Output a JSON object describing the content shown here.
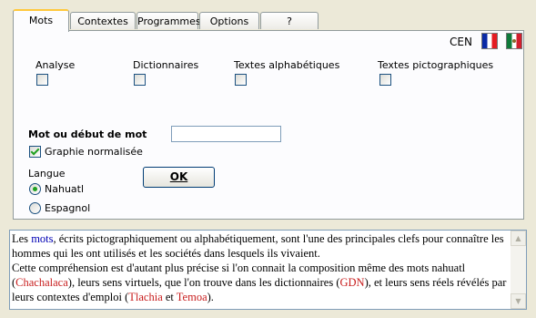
{
  "tabs": [
    {
      "label": "Mots",
      "active": true
    },
    {
      "label": "Contextes",
      "active": false
    },
    {
      "label": "Programmes",
      "active": false
    },
    {
      "label": "Options",
      "active": false
    },
    {
      "label": "?",
      "active": false
    }
  ],
  "top_right": {
    "code": "CEN",
    "flags": [
      "flag-france-icon",
      "flag-mexico-icon"
    ]
  },
  "categories": [
    {
      "label": "Analyse",
      "checked": false
    },
    {
      "label": "Dictionnaires",
      "checked": false
    },
    {
      "label": "Textes alphabétiques",
      "checked": false
    },
    {
      "label": "Textes pictographiques",
      "checked": false
    }
  ],
  "search": {
    "label": "Mot ou début de mot",
    "value": ""
  },
  "graphie": {
    "label": "Graphie normalisée",
    "checked": true
  },
  "langue": {
    "label": "Langue",
    "options": [
      {
        "label": "Nahuatl",
        "selected": true
      },
      {
        "label": "Espagnol",
        "selected": false
      }
    ]
  },
  "ok_button": {
    "label": "OK"
  },
  "description": {
    "p1_before": "Les ",
    "p1_link": "mots",
    "p1_after": ", écrits pictographiquement ou alphabétiquement, sont l'une des principales clefs pour connaître les hommes qui les ont utilisés et les sociétés dans lesquels ils vivaient.",
    "p2_a": "Cette compréhension est d'autant plus précise si l'on connait la composition même des mots nahuatl (",
    "p2_link1": "Chachalaca",
    "p2_b": "), leurs sens virtuels, que l'on trouve dans les dictionnaires (",
    "p2_link2": "GDN",
    "p2_c": "), et leurs sens réels révélés par leurs contextes d'emploi (",
    "p2_link3": "Tlachia",
    "p2_d": " et ",
    "p2_link4": "Temoa",
    "p2_e": ")."
  }
}
